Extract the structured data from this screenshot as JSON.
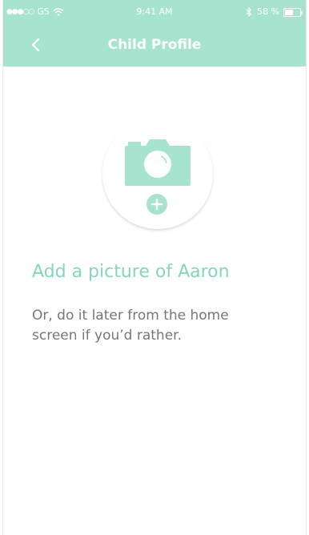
{
  "status_bar": {
    "signal": "●●●○○",
    "carrier": "GS",
    "time": "9:41 AM",
    "battery_percent": "58 %",
    "battery_level": 0.58
  },
  "nav": {
    "title": "Child Profile",
    "back_icon": "chevron-left-icon"
  },
  "photo": {
    "camera_icon": "camera-icon",
    "add_icon": "plus-icon"
  },
  "content": {
    "heading": "Add a picture of Aaron",
    "subtext": "Or, do it later from the home screen if you’d rather."
  },
  "colors": {
    "accent": "#a6e4cf",
    "heading_text": "#86d6bb",
    "body_text": "#777777"
  }
}
